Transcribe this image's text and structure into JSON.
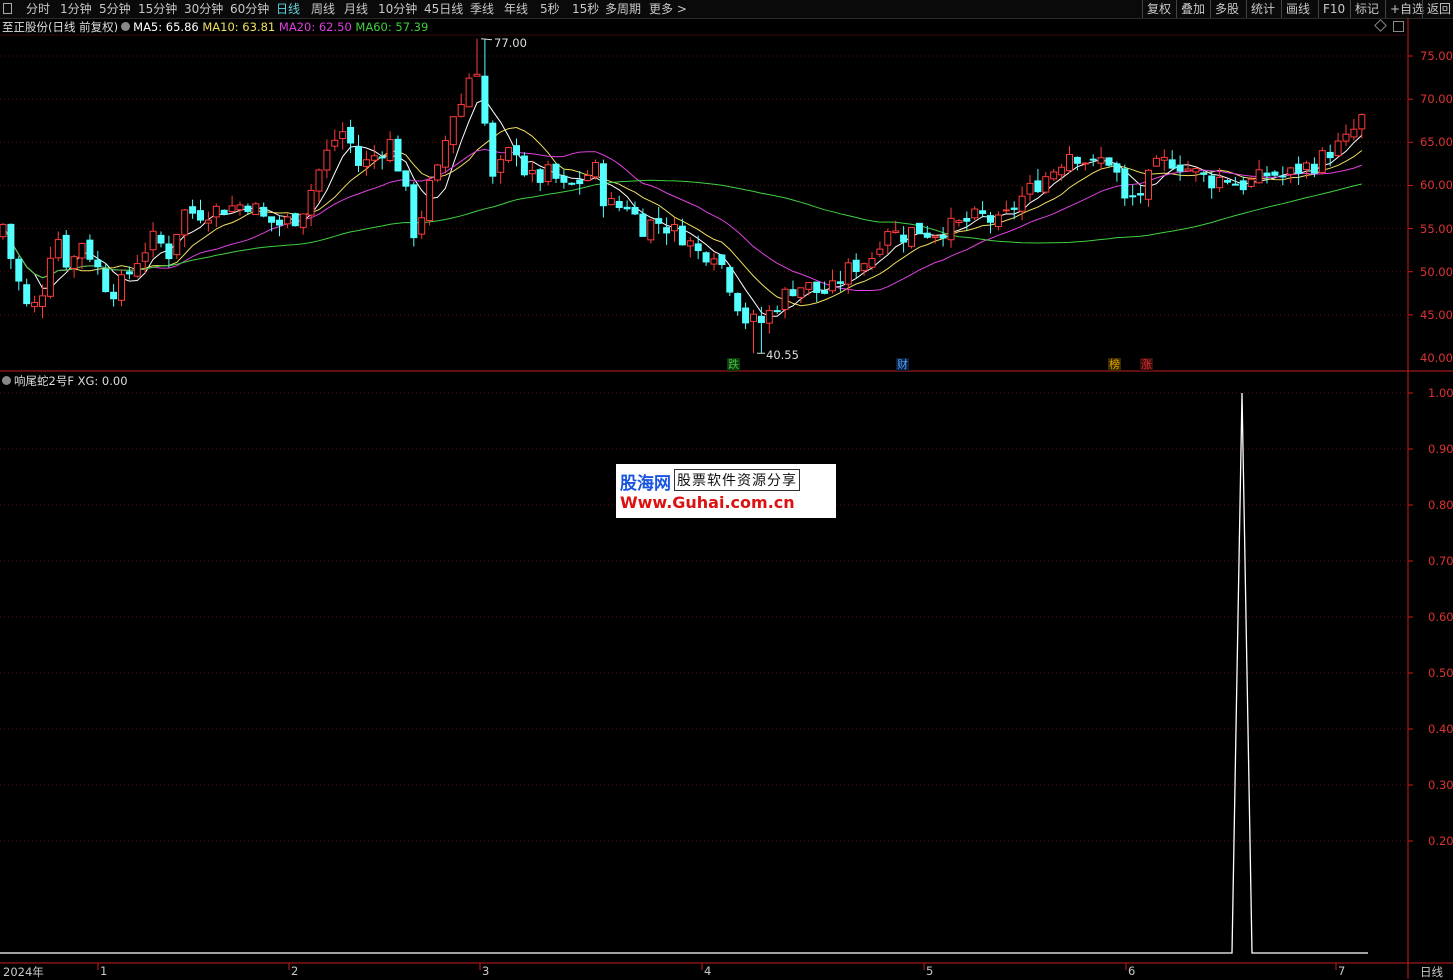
{
  "toolbar": {
    "periods": [
      "分时",
      "1分钟",
      "5分钟",
      "15分钟",
      "30分钟",
      "60分钟",
      "日线",
      "周线",
      "月线",
      "10分钟",
      "45日线",
      "季线",
      "年线",
      "5秒",
      "15秒",
      "多周期",
      "更多 >"
    ],
    "active_period": "日线",
    "right_buttons": [
      "复权",
      "叠加",
      "多股",
      "统计",
      "画线",
      "F10",
      "标记",
      "+自选",
      "返回"
    ]
  },
  "price_panel": {
    "title": "至正股份(日线 前复权)",
    "ma": [
      {
        "label": "MA5: 65.86",
        "color": "#ffffff"
      },
      {
        "label": "MA10: 63.81",
        "color": "#f0e060"
      },
      {
        "label": "MA20: 62.50",
        "color": "#e040e0"
      },
      {
        "label": "MA60: 57.39",
        "color": "#40d040"
      }
    ],
    "y_ticks": [
      "75.00",
      "70.00",
      "65.00",
      "60.00",
      "55.00",
      "50.00",
      "45.00",
      "40.00"
    ],
    "high_label": "77.00",
    "low_label": "40.55",
    "tags": [
      {
        "text": "跌",
        "color": "#40c040"
      },
      {
        "text": "财",
        "color": "#4aa0ff"
      },
      {
        "text": "榜",
        "color": "#e0a000"
      },
      {
        "text": "涨",
        "color": "#e03030"
      }
    ]
  },
  "indicator_panel": {
    "title": "响尾蛇2号F  XG: 0.00",
    "y_ticks": [
      "1.00",
      "0.90",
      "0.80",
      "0.70",
      "0.60",
      "0.50",
      "0.40",
      "0.30",
      "0.20"
    ]
  },
  "date_axis": {
    "labels": [
      "2024年",
      "1",
      "2",
      "3",
      "4",
      "5",
      "6",
      "7"
    ],
    "period_label": "日线"
  },
  "watermark": {
    "logo": "股海网",
    "slogan": "股票软件资源分享",
    "url": "Www.Guhai.com.cn"
  },
  "colors": {
    "up": "#ff3b3b",
    "down": "#54ffff",
    "axis": "#c81e1e",
    "grid": "#5a1010"
  }
}
